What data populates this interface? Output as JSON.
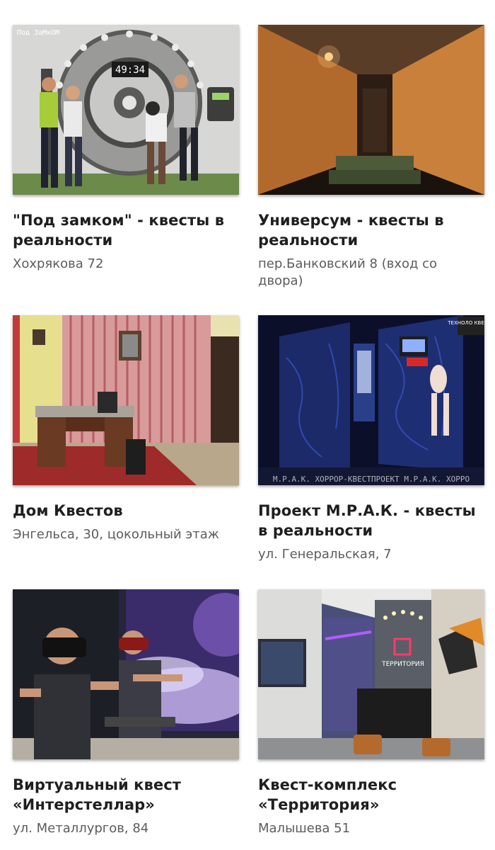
{
  "cards": [
    {
      "title": "\"Под замком\" - квесты в реальности",
      "address": "Хохрякова 72",
      "image": {
        "icon": "vault-door-photo",
        "logo_text": "Под ЗаМкОМ",
        "timer": "49:34"
      }
    },
    {
      "title": "Универсум - квесты в реальности",
      "address": "пер.Банковский 8 (вход со двора)",
      "image": {
        "icon": "dark-corridor-photo"
      }
    },
    {
      "title": "Дом Квестов",
      "address": "Энгельса, 30, цокольный этаж",
      "image": {
        "icon": "office-room-photo"
      }
    },
    {
      "title": "Проект М.Р.А.К. - квесты в реальности",
      "address": "ул. Генеральская, 7",
      "image": {
        "icon": "horror-room-photo",
        "watermark": "М.Р.А.К. ХОРРОР-КВЕСТПРОЕКТ М.Р.А.К. ХОРРО",
        "corner_badge": "ТЕХНОЛО КВЕСТА"
      }
    },
    {
      "title": "Виртуальный квест «Интерстеллар»",
      "address": "ул. Металлургов, 84",
      "image": {
        "icon": "vr-players-photo"
      }
    },
    {
      "title": "Квест-комплекс «Территория»",
      "address": "Малышева 51",
      "image": {
        "icon": "lobby-reception-photo",
        "sign_text": "ТЕРРИТОРИЯ"
      }
    }
  ],
  "colors": {
    "title": "#1f1f1f",
    "address": "#5c5c5c",
    "background": "#ffffff"
  }
}
